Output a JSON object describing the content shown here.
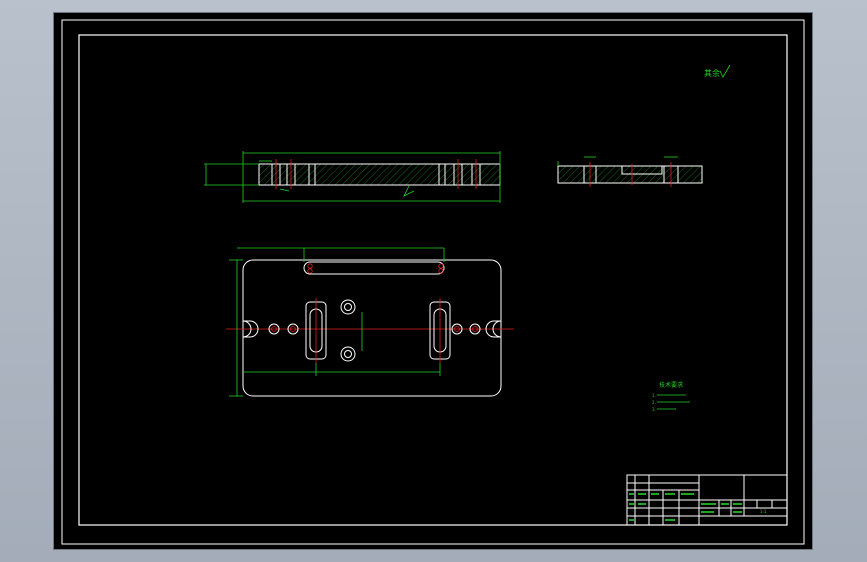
{
  "drawing": {
    "roughness_note": "其余",
    "tech_requirements": {
      "title": "技术要求",
      "items": [
        "1.",
        "2.",
        "3."
      ]
    },
    "title_block": {
      "scale": "1:1"
    }
  },
  "colors": {
    "background": "#000000",
    "border": "#ffffff",
    "dimension": "#25d125",
    "centerline": "#e0201e",
    "outline": "#ffffff"
  }
}
